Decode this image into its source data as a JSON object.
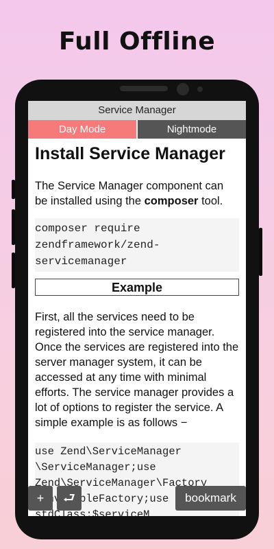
{
  "headline": "Full Offline",
  "app": {
    "title": "Service Manager",
    "day_mode": "Day Mode",
    "night_mode": "Nightmode"
  },
  "article": {
    "heading": "Install Service Manager",
    "intro_pre": "The Service Manager component can be installed using the ",
    "intro_bold": "composer",
    "intro_post": " tool.",
    "code1": [
      "composer require",
      "zendframework/zend-",
      "servicemanager"
    ],
    "example_label": "Example",
    "paragraph": "First, all the services need to be registered into the service manager. Once the services are registered into the server manager system, it can be accessed at any time with minimal efforts. The service manager provides a lot of options to register the service. A simple example is as follows −",
    "code2": [
      "use Zend\\ServiceManager",
      "\\ServiceManager;use",
      "Zend\\ServiceManager\\Factory",
      "\\InvokableFactory;use",
      "stdClass;$serviceM"
    ]
  },
  "controls": {
    "plus_label": "+",
    "return_label": "⮐",
    "bookmark_label": "bookmark"
  },
  "colors": {
    "day_mode": "#f77a7a",
    "night_mode": "#555555",
    "title_bar": "#d6d6d6"
  }
}
